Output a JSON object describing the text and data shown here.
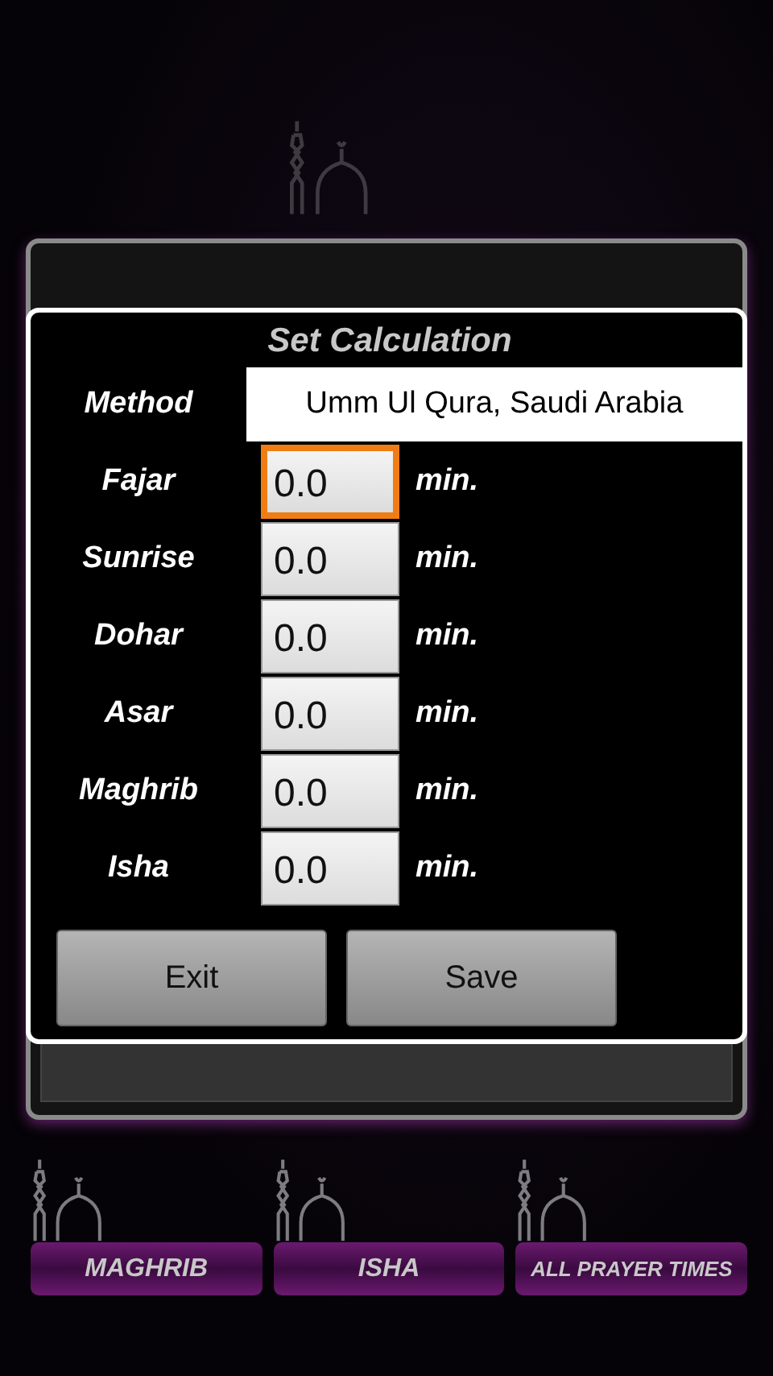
{
  "dialog": {
    "title": "Set Calculation",
    "method": {
      "label": "Method",
      "value": "Umm Ul Qura, Saudi Arabia"
    },
    "offsets": [
      {
        "label": "Fajar",
        "value": "0.0",
        "unit": "min.",
        "focused": true
      },
      {
        "label": "Sunrise",
        "value": "0.0",
        "unit": "min.",
        "focused": false
      },
      {
        "label": "Dohar",
        "value": "0.0",
        "unit": "min.",
        "focused": false
      },
      {
        "label": "Asar",
        "value": "0.0",
        "unit": "min.",
        "focused": false
      },
      {
        "label": "Maghrib",
        "value": "0.0",
        "unit": "min.",
        "focused": false
      },
      {
        "label": "Isha",
        "value": "0.0",
        "unit": "min.",
        "focused": false
      }
    ],
    "buttons": [
      "Exit",
      "Save"
    ]
  },
  "nav_buttons": [
    "MAGHRIB",
    "ISHA",
    "ALL PRAYER TIMES"
  ]
}
